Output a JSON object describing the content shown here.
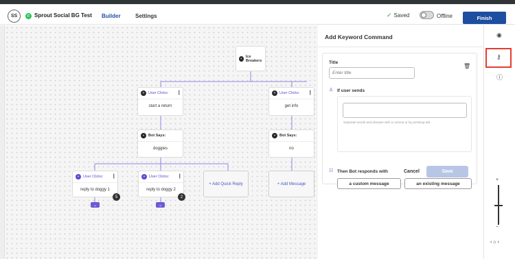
{
  "header": {
    "avatar_initials": "SS",
    "bot_name": "Sprout Social BG Test",
    "tabs": [
      {
        "label": "Builder",
        "active": true
      },
      {
        "label": "Settings",
        "active": false
      }
    ],
    "saved_label": "Saved",
    "offline_label": "Offline",
    "finish_label": "Finish"
  },
  "flow": {
    "root_label": "Ice Breakers",
    "user_clicks": "User Clicks:",
    "bot_says": "Bot Says:",
    "left_user": "start a return",
    "left_bot": "doggies",
    "right_user": "get info",
    "right_bot": "no",
    "child1": "reply to doggy 1",
    "child2": "reply to doggy 2",
    "badge1": "5",
    "badge2": "2",
    "add_quick_reply": "+ Add Quick Reply",
    "add_message": "+ Add Message"
  },
  "panel": {
    "title": "Add Keyword Command",
    "title_label": "Title",
    "title_placeholder": "Enter title",
    "if_user_sends": "If user sends",
    "hint": "Separate words and phrases with a comma or by pressing tab.",
    "then_bot": "Then Bot responds with",
    "option_custom": "a custom message",
    "option_existing": "an existing message",
    "cancel": "Cancel",
    "save": "Save"
  },
  "colors": {
    "accent": "#1d4ea0",
    "purple": "#5b4ad1",
    "highlight": "#e53b2f"
  }
}
